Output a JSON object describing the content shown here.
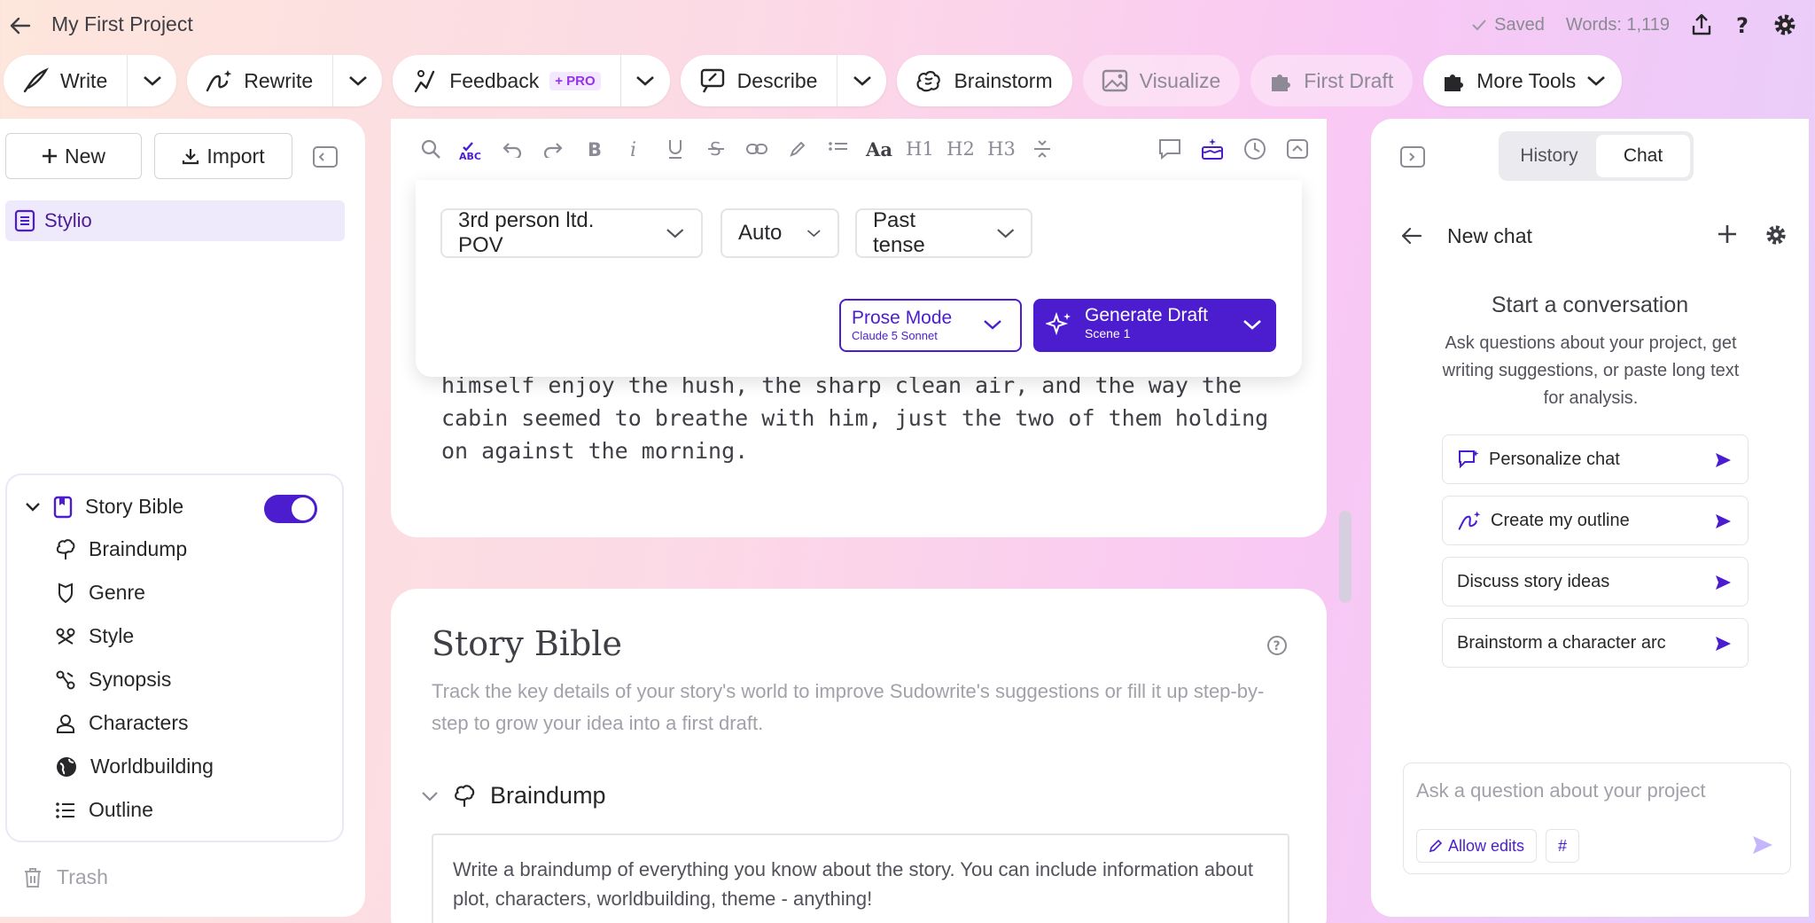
{
  "header": {
    "project_title": "My First Project",
    "saved_label": "Saved",
    "words_label": "Words: 1,119"
  },
  "toolbar": {
    "write": "Write",
    "rewrite": "Rewrite",
    "feedback": "Feedback",
    "feedback_badge": "+ PRO",
    "describe": "Describe",
    "brainstorm": "Brainstorm",
    "visualize": "Visualize",
    "first_draft": "First Draft",
    "more_tools": "More Tools"
  },
  "sidebar": {
    "new_label": "New",
    "import_label": "Import",
    "document": "Stylio",
    "story_bible_label": "Story Bible",
    "story_bible_enabled": true,
    "items": [
      {
        "label": "Braindump",
        "icon": "brain-icon"
      },
      {
        "label": "Genre",
        "icon": "genre-icon"
      },
      {
        "label": "Style",
        "icon": "style-icon"
      },
      {
        "label": "Synopsis",
        "icon": "synopsis-icon"
      },
      {
        "label": "Characters",
        "icon": "characters-icon"
      },
      {
        "label": "Worldbuilding",
        "icon": "globe-icon"
      },
      {
        "label": "Outline",
        "icon": "list-icon"
      }
    ],
    "trash_label": "Trash"
  },
  "editor": {
    "format_h1": "H1",
    "format_h2": "H2",
    "format_h3": "H3",
    "format_aa": "Aa",
    "prose_text": "himself enjoy the hush, the sharp clean air, and the way the cabin seemed to breathe with him, just the two of them holding on against the morning."
  },
  "draft_popup": {
    "pov": "3rd person ltd. POV",
    "length": "Auto",
    "tense": "Past tense",
    "prose_mode": "Prose Mode",
    "prose_model": "Claude 5 Sonnet",
    "generate": "Generate Draft",
    "generate_sub": "Scene 1"
  },
  "story_bible": {
    "title": "Story Bible",
    "description": "Track the key details of your story's world to improve Sudowrite's suggestions or fill it up step-by-step to grow your idea into a first draft.",
    "braindump_heading": "Braindump",
    "braindump_text": "Write a braindump of everything you know about the story. You can include information about plot, characters, worldbuilding, theme - anything!"
  },
  "chat": {
    "tab_history": "History",
    "tab_chat": "Chat",
    "active_tab": "Chat",
    "header": "New chat",
    "start_title": "Start a conversation",
    "start_desc": "Ask questions about your project, get writing suggestions, or paste long text for analysis.",
    "suggestions": [
      "Personalize chat",
      "Create my outline",
      "Discuss story ideas",
      "Brainstorm a character arc"
    ],
    "input_placeholder": "Ask a question about your project",
    "allow_edits": "Allow edits",
    "hash_chip": "#"
  },
  "colors": {
    "accent": "#4c1dcf",
    "pro_badge": "#9333ea"
  }
}
